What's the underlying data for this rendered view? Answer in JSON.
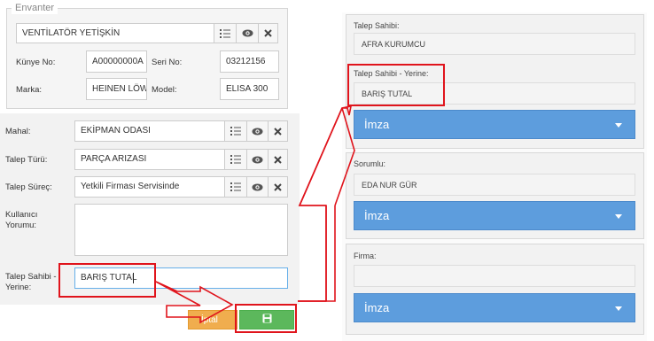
{
  "inventory": {
    "legend": "Envanter",
    "device_name": "VENTİLATÖR YETİŞKİN",
    "kunye_label": "Künye No:",
    "kunye_value": "A00000000A",
    "seri_label": "Seri No:",
    "seri_value": "03212156",
    "marka_label": "Marka:",
    "marka_value": "HEINEN LÖW",
    "model_label": "Model:",
    "model_value": "ELISA 300"
  },
  "form": {
    "mahal_label": "Mahal:",
    "mahal_value": "EKİPMAN ODASI",
    "talep_turu_label": "Talep Türü:",
    "talep_turu_value": "PARÇA ARIZASI",
    "talep_surec_label": "Talep Süreç:",
    "talep_surec_value": "Yetkili Firması Servisinde",
    "kullanici_label": "Kullanıcı Yorumu:",
    "kullanici_value": "",
    "talep_sahibi_yerine_label": "Talep Sahibi - Yerine:",
    "talep_sahibi_yerine_value": "BARIŞ TUTAL",
    "cancel_label": "İptal"
  },
  "right_panel": {
    "talep_sahibi_label": "Talep Sahibi:",
    "talep_sahibi_value": "AFRA KURUMCU",
    "talep_sahibi_yerine_label": "Talep Sahibi - Yerine:",
    "talep_sahibi_yerine_value": "BARIŞ TUTAL",
    "imza_label": "İmza",
    "sorumlu_label": "Sorumlu:",
    "sorumlu_value": "EDA NUR GÜR",
    "firma_label": "Firma:",
    "firma_value": ""
  },
  "colors": {
    "annotation_red": "#e0141c",
    "imza_blue": "#5d9ddd",
    "save_green": "#5cb85c",
    "cancel_orange": "#f0ad4e"
  },
  "icons": [
    "list-icon",
    "eye-icon",
    "times-icon",
    "floppy-icon",
    "caret-down-icon"
  ]
}
